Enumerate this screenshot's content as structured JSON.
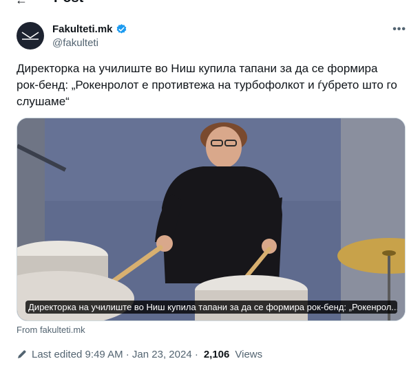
{
  "header": {
    "title": "Post",
    "back_icon": "arrow-left-icon"
  },
  "author": {
    "display_name": "Fakulteti.mk",
    "handle": "@fakulteti",
    "verified_color": "#1d9bf0"
  },
  "tweet": {
    "text": "Директорка на училиште во Ниш купила тапани за да се формира рок-бенд: „Рокенролот е противтежа на турбофолкот и ѓубрето што го слушаме“",
    "media_caption": "Директорка на училиште во Ниш купила тапани за да се формира рок-бенд: „Рокенрол...",
    "source": "From fakulteti.mk"
  },
  "meta": {
    "edited": "Last edited 9:49 AM · Jan 23, 2024 ·",
    "views_count": "2,106",
    "views_label": "Views"
  }
}
